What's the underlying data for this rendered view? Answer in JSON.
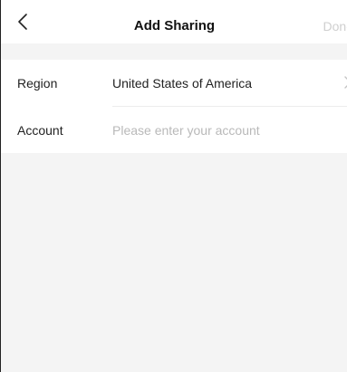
{
  "navbar": {
    "title": "Add Sharing",
    "done_label": "Done",
    "back_icon": "chevron-left-icon"
  },
  "form": {
    "region": {
      "label": "Region",
      "value": "United States of America"
    },
    "account": {
      "label": "Account",
      "placeholder": "Please enter your account",
      "value": ""
    }
  },
  "colors": {
    "background": "#f4f4f4",
    "surface": "#ffffff",
    "done_disabled": "#cfcfcf",
    "placeholder": "#b9b9b9"
  }
}
